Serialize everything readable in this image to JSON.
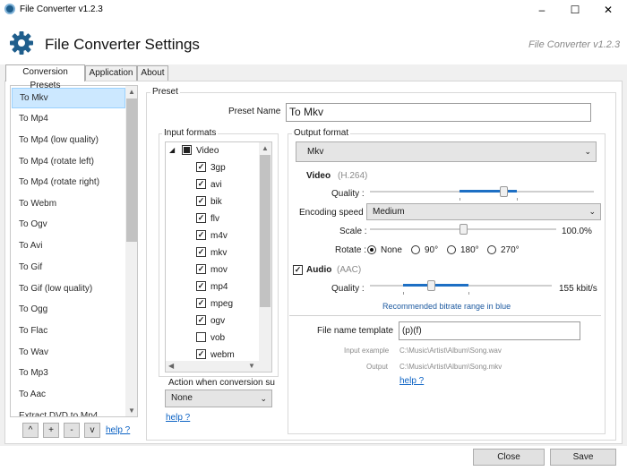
{
  "window": {
    "title": "File Converter v1.2.3",
    "minimize": "–",
    "maximize": "☐",
    "close": "✕"
  },
  "header": {
    "title": "File Converter Settings",
    "version": "File Converter v1.2.3"
  },
  "tabs": [
    "Conversion Presets",
    "Application",
    "About"
  ],
  "presets": {
    "items": [
      "To Mkv",
      "To Mp4",
      "To Mp4 (low quality)",
      "To Mp4 (rotate left)",
      "To Mp4 (rotate right)",
      "To Webm",
      "To Ogv",
      "To Avi",
      "To Gif",
      "To Gif (low quality)",
      "To Ogg",
      "To Flac",
      "To Wav",
      "To Mp3",
      "To Aac",
      "Extract DVD to Mp4"
    ],
    "selected": "To Mkv",
    "buttons": {
      "up": "^",
      "add": "+",
      "remove": "-",
      "down": "v"
    },
    "help": "help ?"
  },
  "preset": {
    "group_label": "Preset",
    "name_label": "Preset Name",
    "name_value": "To Mkv",
    "input_formats": {
      "label": "Input formats",
      "root": "Video",
      "items": [
        {
          "name": "3gp",
          "checked": true
        },
        {
          "name": "avi",
          "checked": true
        },
        {
          "name": "bik",
          "checked": true
        },
        {
          "name": "flv",
          "checked": true
        },
        {
          "name": "m4v",
          "checked": true
        },
        {
          "name": "mkv",
          "checked": true
        },
        {
          "name": "mov",
          "checked": true
        },
        {
          "name": "mp4",
          "checked": true
        },
        {
          "name": "mpeg",
          "checked": true
        },
        {
          "name": "ogv",
          "checked": true
        },
        {
          "name": "vob",
          "checked": false
        },
        {
          "name": "webm",
          "checked": true
        }
      ]
    },
    "action_label": "Action when conversion su",
    "action_value": "None",
    "help": "help ?",
    "output": {
      "label": "Output format",
      "format": "Mkv",
      "video_label": "Video",
      "video_codec": "(H.264)",
      "quality_label": "Quality :",
      "encoding_label": "Encoding speed :",
      "encoding_value": "Medium",
      "scale_label": "Scale :",
      "scale_value": "100.0%",
      "rotate_label": "Rotate :",
      "rotate_options": [
        "None",
        "90°",
        "180°",
        "270°"
      ],
      "rotate_selected": "None",
      "video_quality_level": 0.6,
      "scale_level": 0.5,
      "audio_label": "Audio",
      "audio_codec": "(AAC)",
      "audio_checked": true,
      "audio_quality_label": "Quality :",
      "audio_quality_value": "155 kbit/s",
      "audio_quality_level": 0.33,
      "recommended": "Recommended bitrate range in blue",
      "template_label": "File name template",
      "template_value": "(p)(f)",
      "input_example_label": "Input example",
      "input_example_value": "C:\\Music\\Artist\\Album\\Song.wav",
      "output_label": "Output",
      "output_value": "C:\\Music\\Artist\\Album\\Song.mkv",
      "help": "help ?"
    }
  },
  "footer": {
    "close": "Close",
    "save": "Save"
  },
  "colors": {
    "accent": "#1d6fc4",
    "selection": "#cce8ff",
    "gear": "#1f5e8c"
  }
}
